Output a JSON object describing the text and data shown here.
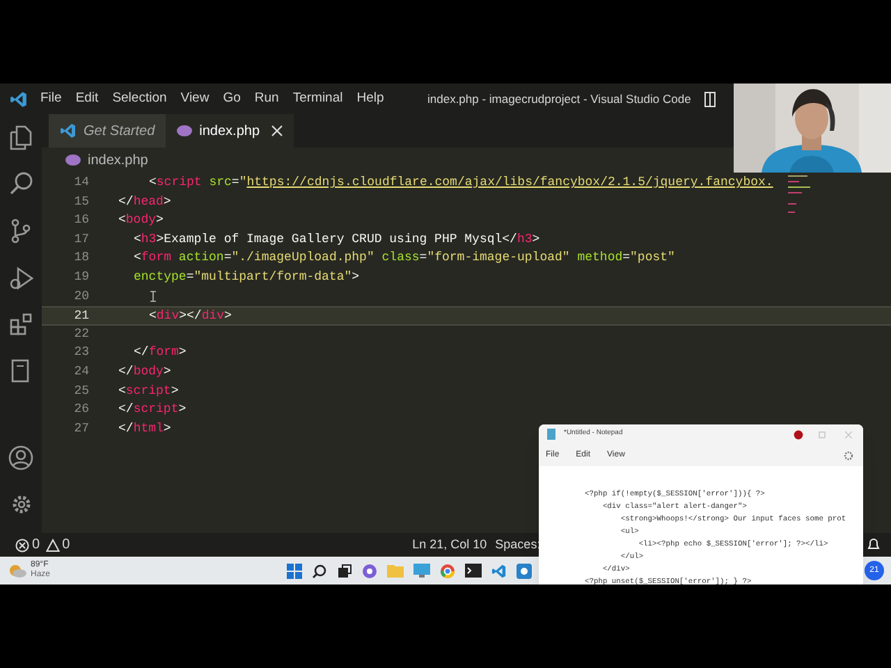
{
  "title_bar": {
    "menu": [
      "File",
      "Edit",
      "Selection",
      "View",
      "Go",
      "Run",
      "Terminal",
      "Help"
    ],
    "title": "index.php - imagecrudproject - Visual Studio Code"
  },
  "tabs": [
    {
      "label": "Get Started",
      "kind": "welcome",
      "selected": false,
      "closable": false
    },
    {
      "label": "index.php",
      "kind": "php",
      "selected": true,
      "closable": true
    }
  ],
  "breadcrumb": {
    "file": "index.php"
  },
  "editor": {
    "lines": [
      {
        "number": "14",
        "current": false,
        "kind": "nested",
        "tokens": [
          {
            "kind": "punct",
            "text": "<"
          },
          {
            "kind": "tag",
            "text": "script "
          },
          {
            "kind": "attr",
            "text": "src"
          },
          {
            "kind": "punct",
            "text": "="
          },
          {
            "kind": "string",
            "text": "\""
          },
          {
            "kind": "link",
            "text": "https://cdnjs.cloudflare.com/ajax/libs/fancybox/2.1.5/jquery.fancybox."
          }
        ]
      },
      {
        "number": "15",
        "current": false,
        "tokens": [
          {
            "kind": "punct",
            "text": "</"
          },
          {
            "kind": "tag",
            "text": "head"
          },
          {
            "kind": "punct",
            "text": ">"
          }
        ]
      },
      {
        "number": "16",
        "current": false,
        "tokens": [
          {
            "kind": "punct",
            "text": "<"
          },
          {
            "kind": "tag",
            "text": "body"
          },
          {
            "kind": "punct",
            "text": ">"
          }
        ]
      },
      {
        "number": "17",
        "current": false,
        "kind": "indented",
        "tokens": [
          {
            "kind": "punct",
            "text": "<"
          },
          {
            "kind": "tag",
            "text": "h3"
          },
          {
            "kind": "punct",
            "text": ">Example of Image Gallery CRUD using PHP Mysql</"
          },
          {
            "kind": "tag",
            "text": "h3"
          },
          {
            "kind": "punct",
            "text": ">"
          }
        ]
      },
      {
        "number": "18",
        "current": false,
        "kind": "indented",
        "tokens": [
          {
            "kind": "punct",
            "text": "<"
          },
          {
            "kind": "tag",
            "text": "form "
          },
          {
            "kind": "attr",
            "text": "action"
          },
          {
            "kind": "punct",
            "text": "="
          },
          {
            "kind": "string",
            "text": "\"./imageUpload.php\" "
          },
          {
            "kind": "attr",
            "text": "class"
          },
          {
            "kind": "punct",
            "text": "="
          },
          {
            "kind": "string",
            "text": "\"form-image-upload\" "
          },
          {
            "kind": "attr",
            "text": "method"
          },
          {
            "kind": "punct",
            "text": "="
          },
          {
            "kind": "string",
            "text": "\"post\""
          }
        ]
      },
      {
        "number": "19",
        "current": false,
        "kind": "indented",
        "tokens": [
          {
            "kind": "attr",
            "text": "enctype"
          },
          {
            "kind": "punct",
            "text": "="
          },
          {
            "kind": "string",
            "text": "\"multipart/form-data\""
          },
          {
            "kind": "punct",
            "text": ">"
          }
        ]
      },
      {
        "number": "20",
        "current": false
      },
      {
        "number": "21",
        "current": true,
        "kind": "nested",
        "tokens": [
          {
            "kind": "punct",
            "text": "<"
          },
          {
            "kind": "tag",
            "text": "div"
          },
          {
            "kind": "punct",
            "text": "></"
          },
          {
            "kind": "tag",
            "text": "div"
          },
          {
            "kind": "punct",
            "text": ">"
          }
        ]
      },
      {
        "number": "22",
        "current": false
      },
      {
        "number": "23",
        "current": false,
        "kind": "indented",
        "tokens": [
          {
            "kind": "punct",
            "text": "</"
          },
          {
            "kind": "tag",
            "text": "form"
          },
          {
            "kind": "punct",
            "text": ">"
          }
        ]
      },
      {
        "number": "24",
        "current": false,
        "tokens": [
          {
            "kind": "punct",
            "text": "</"
          },
          {
            "kind": "tag",
            "text": "body"
          },
          {
            "kind": "punct",
            "text": ">"
          }
        ]
      },
      {
        "number": "25",
        "current": false,
        "tokens": [
          {
            "kind": "punct",
            "text": "<"
          },
          {
            "kind": "tag",
            "text": "script"
          },
          {
            "kind": "punct",
            "text": ">"
          }
        ]
      },
      {
        "number": "26",
        "current": false,
        "tokens": [
          {
            "kind": "punct",
            "text": "</"
          },
          {
            "kind": "tag",
            "text": "script"
          },
          {
            "kind": "punct",
            "text": ">"
          }
        ]
      },
      {
        "number": "27",
        "current": false,
        "tokens": [
          {
            "kind": "punct",
            "text": "</"
          },
          {
            "kind": "tag",
            "text": "html"
          },
          {
            "kind": "punct",
            "text": ">"
          }
        ]
      }
    ]
  },
  "status_bar": {
    "errors": "0",
    "warnings": "0",
    "position": "Ln 21, Col 10",
    "indentation": "Spaces:"
  },
  "taskbar": {
    "weather": {
      "temperature": "89°F",
      "condition": "Haze"
    },
    "notification_count": "21"
  },
  "notepad": {
    "title": "*Untitled - Notepad",
    "menu": [
      "File",
      "Edit",
      "View"
    ],
    "lines": [
      "<?php if(!empty($_SESSION['error'])){ ?>",
      "    <div class=\"alert alert-danger\">",
      "        <strong>Whoops!</strong> Our input faces some prot",
      "        <ul>",
      "            <li><?php echo $_SESSION['error']; ?></li>",
      "        </ul>",
      "    </div>",
      "<?php unset($_SESSION['error']); } ?>"
    ]
  }
}
